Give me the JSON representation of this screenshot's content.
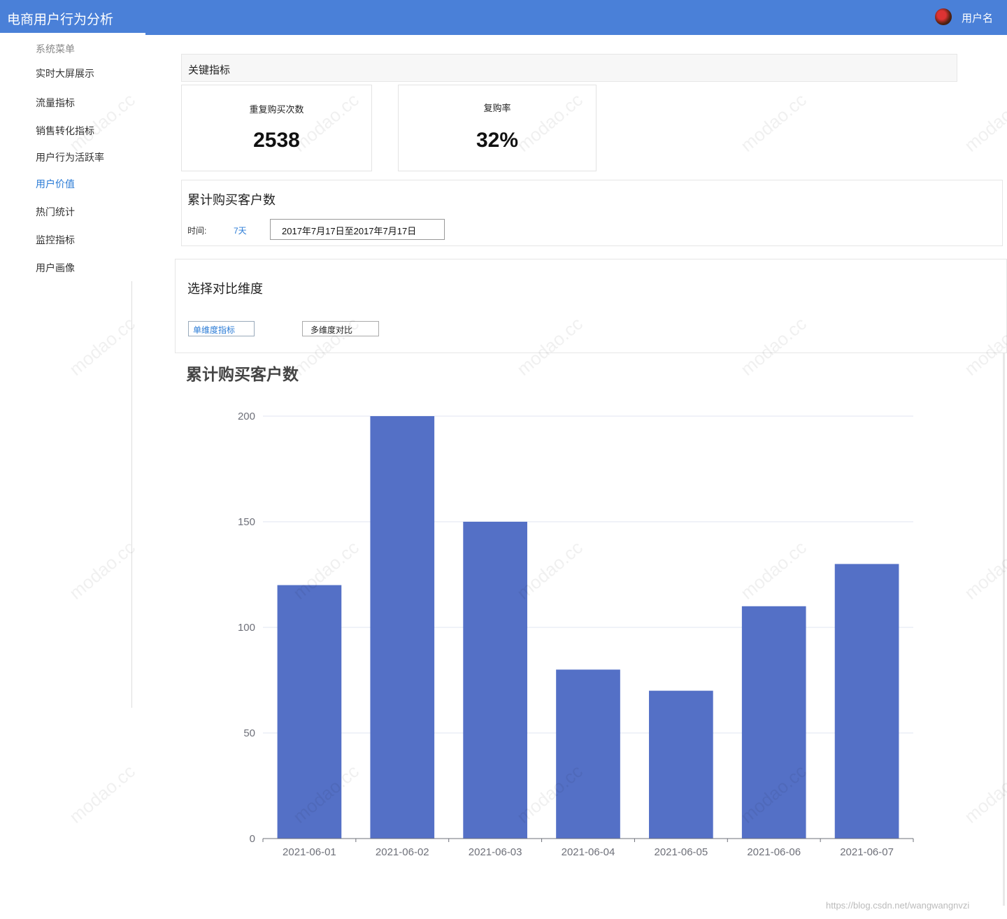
{
  "header": {
    "title": "电商用户行为分析",
    "username": "用户名"
  },
  "sidebar": {
    "title": "系统菜单",
    "items": [
      {
        "label": "实时大屏展示"
      },
      {
        "label": "流量指标"
      },
      {
        "label": "销售转化指标"
      },
      {
        "label": "用户行为活跃率"
      },
      {
        "label": "用户价值",
        "active": true
      },
      {
        "label": "热门统计"
      },
      {
        "label": "监控指标"
      },
      {
        "label": "用户画像"
      }
    ]
  },
  "key_metrics": {
    "title": "关键指标",
    "cards": [
      {
        "label": "重复购买次数",
        "value": "2538"
      },
      {
        "label": "复购率",
        "value": "32%"
      }
    ]
  },
  "cumulative": {
    "title": "累计购买客户数",
    "time_label": "时间:",
    "range_link": "7天",
    "date_range": "2017年7月17日至2017年7月17日"
  },
  "compare": {
    "title": "选择对比维度",
    "single_button": "单维度指标",
    "multi_button": "多维度对比"
  },
  "chart_data": {
    "type": "bar",
    "title": "累计购买客户数",
    "categories": [
      "2021-06-01",
      "2021-06-02",
      "2021-06-03",
      "2021-06-04",
      "2021-06-05",
      "2021-06-06",
      "2021-06-07"
    ],
    "values": [
      120,
      200,
      150,
      80,
      70,
      110,
      130
    ],
    "ylim": [
      0,
      200
    ],
    "yticks": [
      0,
      50,
      100,
      150,
      200
    ],
    "color": "#5470c6",
    "grid": true
  },
  "footer": {
    "credit": "https://blog.csdn.net/wangwangnvzi"
  },
  "watermark": "modao.cc"
}
